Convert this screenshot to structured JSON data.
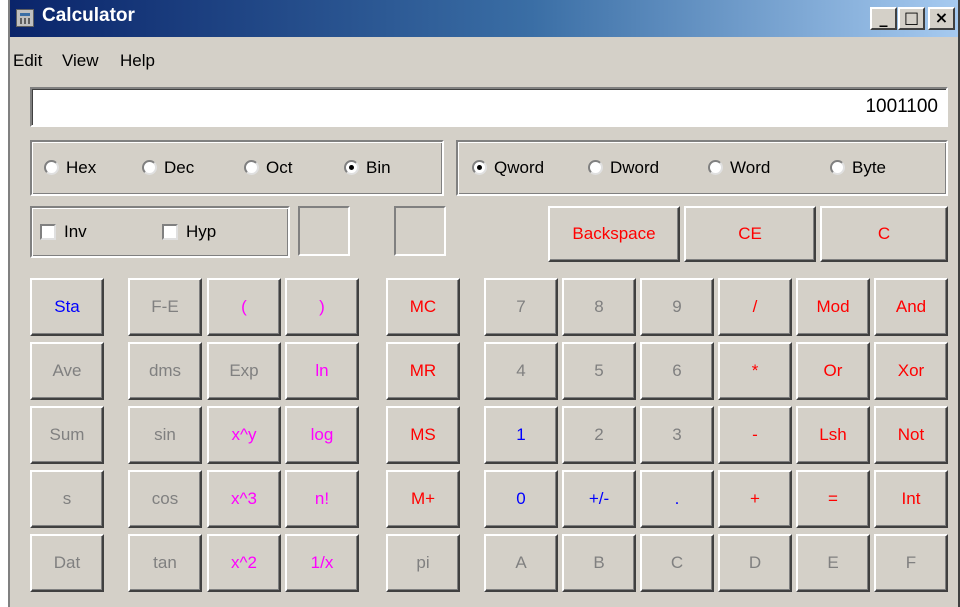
{
  "window": {
    "title": "Calculator"
  },
  "titlebar_buttons": {
    "minimize": "_",
    "maximize": "□",
    "close": "×"
  },
  "menu": [
    "Edit",
    "View",
    "Help"
  ],
  "display": {
    "value": "1001100"
  },
  "base_options": [
    {
      "label": "Hex",
      "selected": false
    },
    {
      "label": "Dec",
      "selected": false
    },
    {
      "label": "Oct",
      "selected": false
    },
    {
      "label": "Bin",
      "selected": true
    }
  ],
  "word_options": [
    {
      "label": "Qword",
      "selected": true
    },
    {
      "label": "Dword",
      "selected": false
    },
    {
      "label": "Word",
      "selected": false
    },
    {
      "label": "Byte",
      "selected": false
    }
  ],
  "checks": [
    {
      "label": "Inv",
      "checked": false
    },
    {
      "label": "Hyp",
      "checked": false
    }
  ],
  "edit_buttons": [
    "Backspace",
    "CE",
    "C"
  ],
  "keypad": [
    [
      "Sta",
      "F-E",
      "(",
      ")",
      "MC",
      "7",
      "8",
      "9",
      "/",
      "Mod",
      "And"
    ],
    [
      "Ave",
      "dms",
      "Exp",
      "ln",
      "MR",
      "4",
      "5",
      "6",
      "*",
      "Or",
      "Xor"
    ],
    [
      "Sum",
      "sin",
      "x^y",
      "log",
      "MS",
      "1",
      "2",
      "3",
      "-",
      "Lsh",
      "Not"
    ],
    [
      "s",
      "cos",
      "x^3",
      "n!",
      "M+",
      "0",
      "+/-",
      ".",
      "+",
      "=",
      "Int"
    ],
    [
      "Dat",
      "tan",
      "x^2",
      "1/x",
      "pi",
      "A",
      "B",
      "C",
      "D",
      "E",
      "F"
    ]
  ],
  "colors": {
    "blue": "#0000ff",
    "red": "#ff0000",
    "magenta": "#ff00ff",
    "disabled": "#808080",
    "face": "#d4d0c8",
    "title_start": "#0a246a",
    "title_end": "#a6caf0"
  }
}
